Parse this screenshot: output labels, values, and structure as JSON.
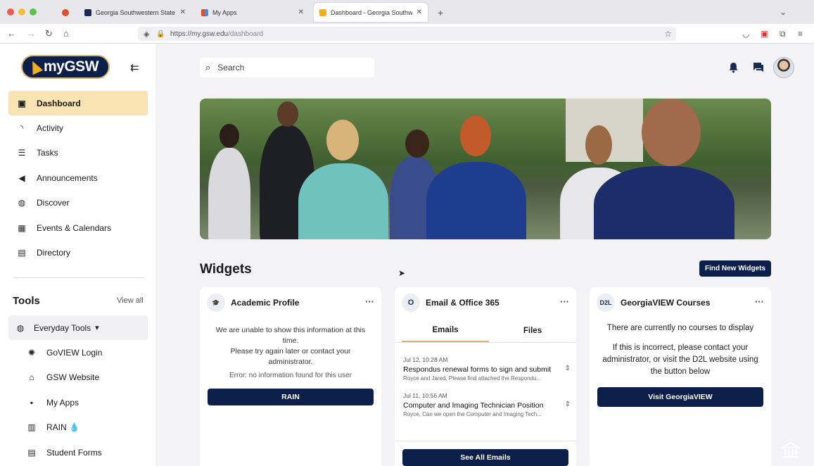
{
  "browser": {
    "tabs": [
      {
        "title": "",
        "favicon_color": "#e24b2b"
      },
      {
        "title": "Georgia Southwestern State Uni",
        "favicon_color": "#1b2a52"
      },
      {
        "title": "My Apps",
        "favicon_color": "#3a8ee6"
      },
      {
        "title": "Dashboard - Georgia Southwest",
        "favicon_color": "#f2b01e"
      }
    ],
    "close_glyph": "✕",
    "new_tab": "+",
    "url_host": "https://my.gsw.edu",
    "url_path": "/dashboard"
  },
  "sidebar": {
    "logo_text": "myGSW",
    "collapse_icon": "⇇",
    "nav": [
      {
        "label": "Dashboard",
        "icon": "▣"
      },
      {
        "label": "Activity",
        "icon": "◝"
      },
      {
        "label": "Tasks",
        "icon": "☰"
      },
      {
        "label": "Announcements",
        "icon": "◀"
      },
      {
        "label": "Discover",
        "icon": "◍"
      },
      {
        "label": "Events & Calendars",
        "icon": "▦"
      },
      {
        "label": "Directory",
        "icon": "▤"
      }
    ],
    "tools_title": "Tools",
    "view_all": "View all",
    "everyday_tools": "Everyday Tools",
    "everyday_caret": "▾",
    "tools": [
      {
        "label": "GoVIEW Login",
        "icon": "✺"
      },
      {
        "label": "GSW Website",
        "icon": "⌂"
      },
      {
        "label": "My Apps",
        "icon": "▪"
      },
      {
        "label": "RAIN 💧",
        "icon": "▥"
      },
      {
        "label": "Student Forms",
        "icon": "▤"
      }
    ]
  },
  "header": {
    "search_placeholder": "Search",
    "search_icon": "⌕",
    "bell_icon": "🔔",
    "chat_icon": "▬"
  },
  "main": {
    "widgets_title": "Widgets",
    "find_widgets": "Find New Widgets"
  },
  "academic": {
    "title": "Academic Profile",
    "badge": "🎓",
    "more": "···",
    "message_line1": "We are unable to show this information at this",
    "message_line2": "time.",
    "message_line3": "Please try again later or contact your",
    "message_line4": "administrator.",
    "error": "Error: no information found for this user",
    "button": "RAIN"
  },
  "email": {
    "title": "Email & Office 365",
    "badge": "O",
    "more": "···",
    "tab_emails": "Emails",
    "tab_files": "Files",
    "items": [
      {
        "date": "Jul 12, 10:28 AM",
        "subject": "Respondus renewal forms to sign and submit",
        "preview": "Royce and Jared,  Please find attached the Respondu..."
      },
      {
        "date": "Jul 11, 10:56 AM",
        "subject": "Computer and Imaging Technician Position",
        "preview": "Royce,  Can we open the Computer and Imaging Tech..."
      }
    ],
    "chevron": "⇕",
    "button": "See All Emails"
  },
  "georgiaview": {
    "title": "GeorgiaVIEW Courses",
    "badge": "D2L",
    "more": "···",
    "line1": "There are currently no courses to display",
    "line2": "If this is incorrect, please contact your",
    "line3": "administrator, or visit the D2L website using",
    "line4": "the button below",
    "button": "Visit GeorgiaVIEW"
  },
  "colors": {
    "navy": "#0c1f4a",
    "gold": "#d9b56b",
    "active_nav_bg": "#f8e3b2"
  }
}
